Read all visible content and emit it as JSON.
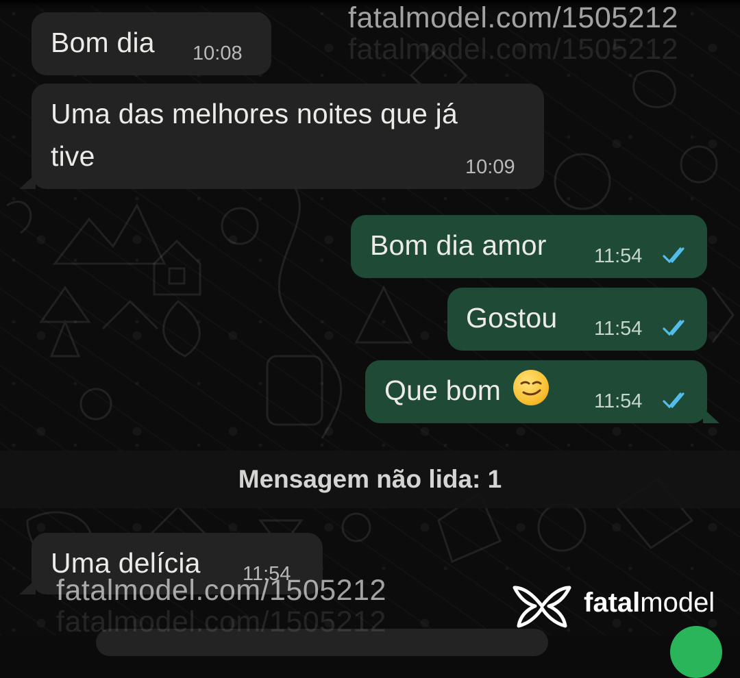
{
  "watermark": {
    "url": "fatalmodel.com/1505212",
    "brand_bold": "fatal",
    "brand_regular": "model"
  },
  "messages": [
    {
      "direction": "in",
      "lines": [
        "Bom dia"
      ],
      "time": "10:08"
    },
    {
      "direction": "in",
      "lines": [
        "Uma das melhores  noites que já",
        "tive"
      ],
      "time": "10:09"
    },
    {
      "direction": "out",
      "lines": [
        "Bom dia amor"
      ],
      "time": "11:54",
      "status": "read"
    },
    {
      "direction": "out",
      "lines": [
        "Gostou"
      ],
      "time": "11:54",
      "status": "read"
    },
    {
      "direction": "out",
      "lines": [
        "Que bom"
      ],
      "time": "11:54",
      "status": "read",
      "emoji": "smirking-face"
    },
    {
      "direction": "in",
      "lines": [
        "Uma delícia"
      ],
      "time": "11:54"
    }
  ],
  "unread_banner": "Mensagem não lida: 1",
  "colors": {
    "incoming_bubble": "#232323",
    "outgoing_bubble": "#1f4a36",
    "read_ticks": "#53bdeb",
    "fab": "#2ab55a"
  }
}
